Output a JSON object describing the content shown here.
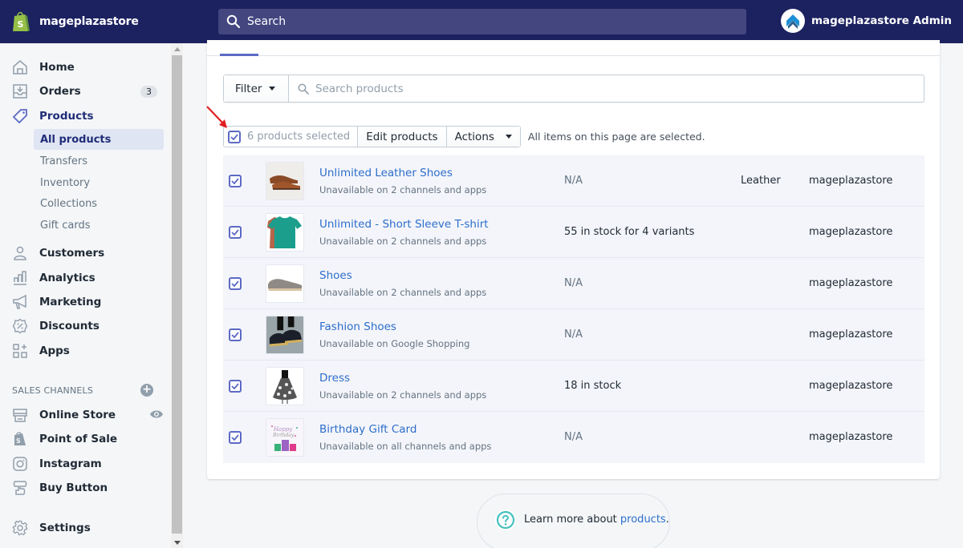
{
  "topbar": {
    "store_name": "mageplazastore",
    "search_placeholder": "Search",
    "account_name": "mageplazastore Admin",
    "brand_color": "#1c2260"
  },
  "sidebar": {
    "items": [
      {
        "label": "Home",
        "icon": "home-icon"
      },
      {
        "label": "Orders",
        "icon": "orders-icon",
        "badge": "3"
      },
      {
        "label": "Products",
        "icon": "tag-icon",
        "active": true
      },
      {
        "label": "Customers",
        "icon": "customer-icon"
      },
      {
        "label": "Analytics",
        "icon": "analytics-icon"
      },
      {
        "label": "Marketing",
        "icon": "megaphone-icon"
      },
      {
        "label": "Discounts",
        "icon": "discount-icon"
      },
      {
        "label": "Apps",
        "icon": "apps-icon"
      }
    ],
    "product_subitems": [
      {
        "label": "All products",
        "selected": true
      },
      {
        "label": "Transfers"
      },
      {
        "label": "Inventory"
      },
      {
        "label": "Collections"
      },
      {
        "label": "Gift cards"
      }
    ],
    "sales_channels_title": "SALES CHANNELS",
    "channels": [
      {
        "label": "Online Store",
        "icon": "store-icon"
      },
      {
        "label": "Point of Sale",
        "icon": "pos-bag-icon"
      },
      {
        "label": "Instagram",
        "icon": "instagram-icon"
      },
      {
        "label": "Buy Button",
        "icon": "buy-button-icon"
      }
    ],
    "settings_label": "Settings"
  },
  "toolbar": {
    "filter_label": "Filter",
    "search_placeholder": "Search products",
    "selected_count_label": "6 products selected",
    "edit_products_label": "Edit products",
    "actions_label": "Actions",
    "selection_note": "All items on this page are selected."
  },
  "products": [
    {
      "title": "Unlimited Leather Shoes",
      "availability": "Unavailable on 2 channels and apps",
      "inventory": "N/A",
      "type": "Leather",
      "vendor": "mageplazastore",
      "checked": true
    },
    {
      "title": "Unlimited - Short Sleeve T-shirt",
      "availability": "Unavailable on 2 channels and apps",
      "inventory": "55 in stock for 4 variants",
      "type": "",
      "vendor": "mageplazastore",
      "checked": true
    },
    {
      "title": "Shoes",
      "availability": "Unavailable on 2 channels and apps",
      "inventory": "N/A",
      "type": "",
      "vendor": "mageplazastore",
      "checked": true
    },
    {
      "title": "Fashion Shoes",
      "availability": "Unavailable on Google Shopping",
      "inventory": "N/A",
      "type": "",
      "vendor": "mageplazastore",
      "checked": true
    },
    {
      "title": "Dress",
      "availability": "Unavailable on 2 channels and apps",
      "inventory": "18 in stock",
      "type": "",
      "vendor": "mageplazastore",
      "checked": true
    },
    {
      "title": "Birthday Gift Card",
      "availability": "Unavailable on all channels and apps",
      "inventory": "N/A",
      "type": "",
      "vendor": "mageplazastore",
      "checked": true
    }
  ],
  "footer": {
    "learn_text": "Learn more about ",
    "learn_link": "products",
    "learn_suffix": "."
  },
  "colors": {
    "accent": "#5c6ac4",
    "link": "#2c6ecb",
    "annotation_arrow": "#e02020"
  }
}
